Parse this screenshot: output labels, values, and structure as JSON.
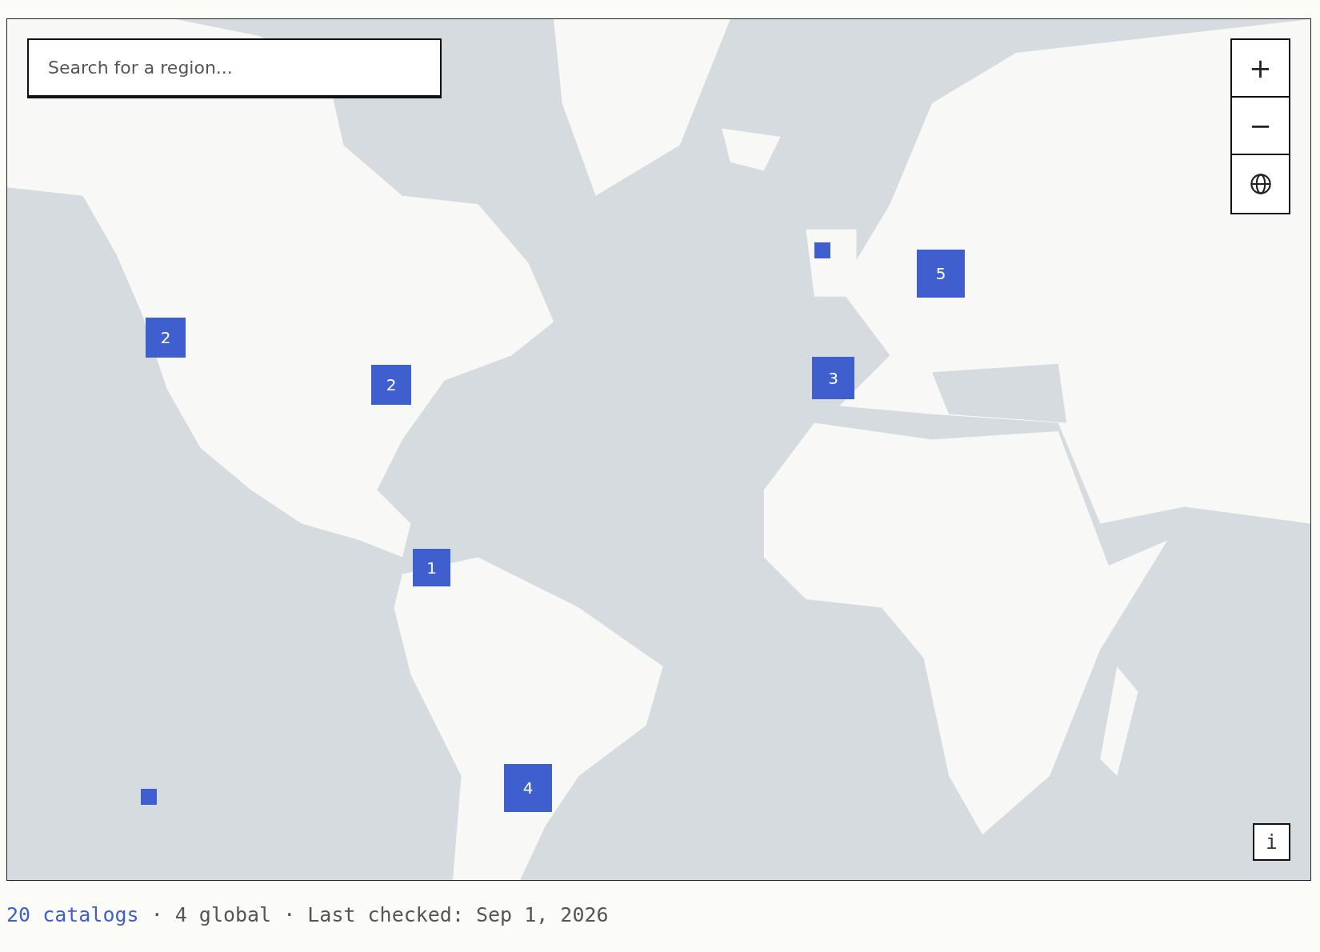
{
  "search": {
    "placeholder": "Search for a region..."
  },
  "map_controls": [
    {
      "kind": "zoom_in",
      "label": "+"
    },
    {
      "kind": "zoom_out",
      "label": "−"
    },
    {
      "kind": "globe"
    }
  ],
  "markers": [
    {
      "kind": "cluster",
      "count": "2"
    },
    {
      "kind": "cluster",
      "count": "2"
    },
    {
      "kind": "cluster",
      "count": "1"
    },
    {
      "kind": "cluster",
      "count": "4"
    },
    {
      "kind": "cluster",
      "count": "3"
    },
    {
      "kind": "cluster",
      "count": "5"
    },
    {
      "kind": "dot"
    },
    {
      "kind": "dot"
    }
  ],
  "info_button": {
    "label": "i"
  },
  "footer": {
    "link": "20 catalogs",
    "text": "· 4 global · Last checked: Sep 1, 2026"
  }
}
